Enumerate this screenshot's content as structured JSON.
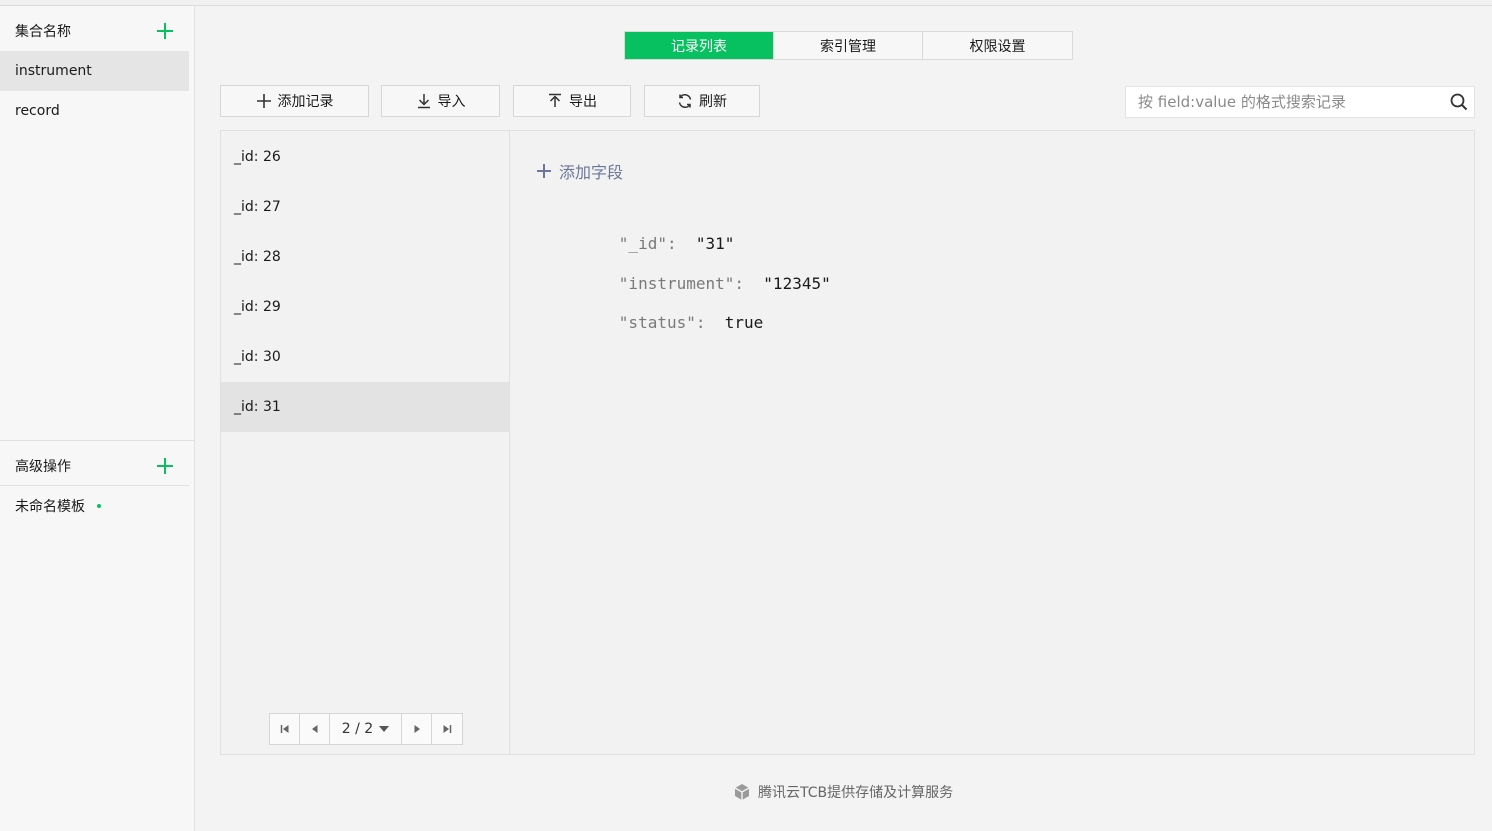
{
  "sidebar": {
    "collections_header": "集合名称",
    "collections": [
      {
        "label": "instrument",
        "active": true
      },
      {
        "label": "record",
        "active": false
      }
    ],
    "advanced_header": "高级操作",
    "templates": [
      {
        "label": "未命名模板"
      }
    ]
  },
  "tabs": [
    {
      "label": "记录列表",
      "active": true
    },
    {
      "label": "索引管理",
      "active": false
    },
    {
      "label": "权限设置",
      "active": false
    }
  ],
  "toolbar": {
    "add_record": "添加记录",
    "import": "导入",
    "export": "导出",
    "refresh": "刷新"
  },
  "search": {
    "placeholder": "按 field:value 的格式搜索记录",
    "value": ""
  },
  "records": [
    {
      "label": "_id: 26"
    },
    {
      "label": "_id: 27"
    },
    {
      "label": "_id: 28"
    },
    {
      "label": "_id: 29"
    },
    {
      "label": "_id: 30"
    },
    {
      "label": "_id: 31",
      "active": true
    }
  ],
  "pagination": {
    "page_display": "2 / 2"
  },
  "detail": {
    "add_field": "添加字段",
    "fields": [
      {
        "key": "\"_id\"",
        "value": "\"31\""
      },
      {
        "key": "\"instrument\"",
        "value": "\"12345\""
      },
      {
        "key": "\"status\"",
        "value": "true"
      }
    ]
  },
  "footer": {
    "text": "腾讯云TCB提供存储及计算服务"
  },
  "colors": {
    "accent": "#07c160",
    "active_row": "#e3e3e3",
    "muted_text": "#6b7796"
  }
}
